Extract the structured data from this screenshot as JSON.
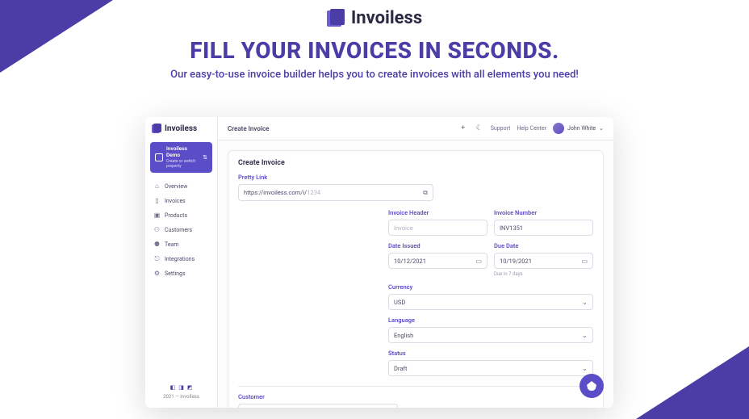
{
  "brand": "Invoiless",
  "hero": {
    "title": "FILL YOUR INVOICES IN SECONDS.",
    "subtitle": "Our easy-to-use invoice builder helps you to create invoices with all elements you need!"
  },
  "topbar": {
    "title": "Create Invoice",
    "links": {
      "support": "Support",
      "help": "Help Center"
    },
    "user": "John White"
  },
  "sidebar": {
    "switch": {
      "title": "Invoiless Demo",
      "sub": "Create or switch property"
    },
    "items": [
      "Overview",
      "Invoices",
      "Products",
      "Customers",
      "Team",
      "Integrations",
      "Settings"
    ],
    "copy": "2021 — Invoiless"
  },
  "form": {
    "title": "Create Invoice",
    "pretty": {
      "label": "Pretty Link",
      "value": "https://invoiless.com/i/",
      "placeholder": "1234"
    },
    "headerField": {
      "label": "Invoice Header",
      "placeholder": "Invoice"
    },
    "number": {
      "label": "Invoice Number",
      "value": "INV1351"
    },
    "dateIssued": {
      "label": "Date Issued",
      "value": "10/12/2021"
    },
    "dueDate": {
      "label": "Due Date",
      "value": "10/19/2021",
      "hint": "Due in 7 days"
    },
    "currency": {
      "label": "Currency",
      "value": "USD"
    },
    "language": {
      "label": "Language",
      "value": "English"
    },
    "status": {
      "label": "Status",
      "value": "Draft"
    },
    "customer": {
      "label": "Customer"
    }
  }
}
